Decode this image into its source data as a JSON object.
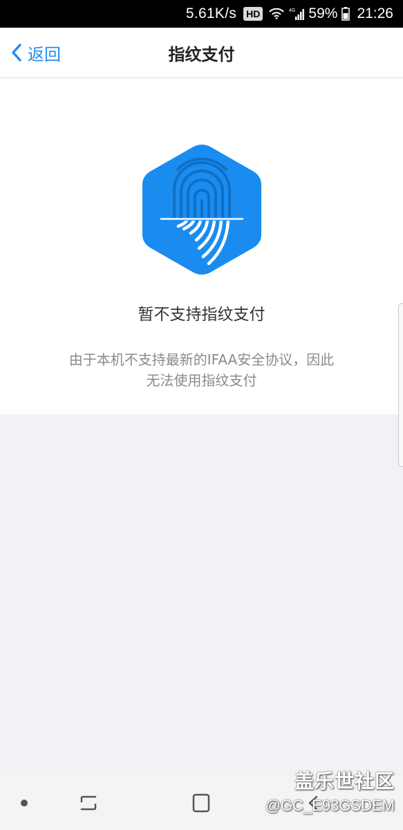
{
  "status_bar": {
    "net_speed": "5.61K/s",
    "hd_badge": "HD",
    "battery_percent": "59%",
    "time": "21:26",
    "icons": [
      "wifi-icon",
      "4g-signal-icon",
      "battery-icon"
    ]
  },
  "nav_bar": {
    "back_label": "返回",
    "title": "指纹支付"
  },
  "content": {
    "logo_icon": "fingerprint-hexagon-icon",
    "main_message": "暂不支持指纹支付",
    "sub_message_line1": "由于本机不支持最新的IFAA安全协议，因此",
    "sub_message_line2": "无法使用指纹支付"
  },
  "system_nav": {
    "icons": [
      "dot-icon",
      "recents-icon",
      "home-icon",
      "back-icon"
    ]
  },
  "watermark": {
    "brand": "盖乐世社区",
    "user": "@GC_E93GSDEM"
  },
  "colors": {
    "accent": "#1f8ef1",
    "logo_blue": "#1a8cf0",
    "page_bg": "#f2f2f6"
  }
}
